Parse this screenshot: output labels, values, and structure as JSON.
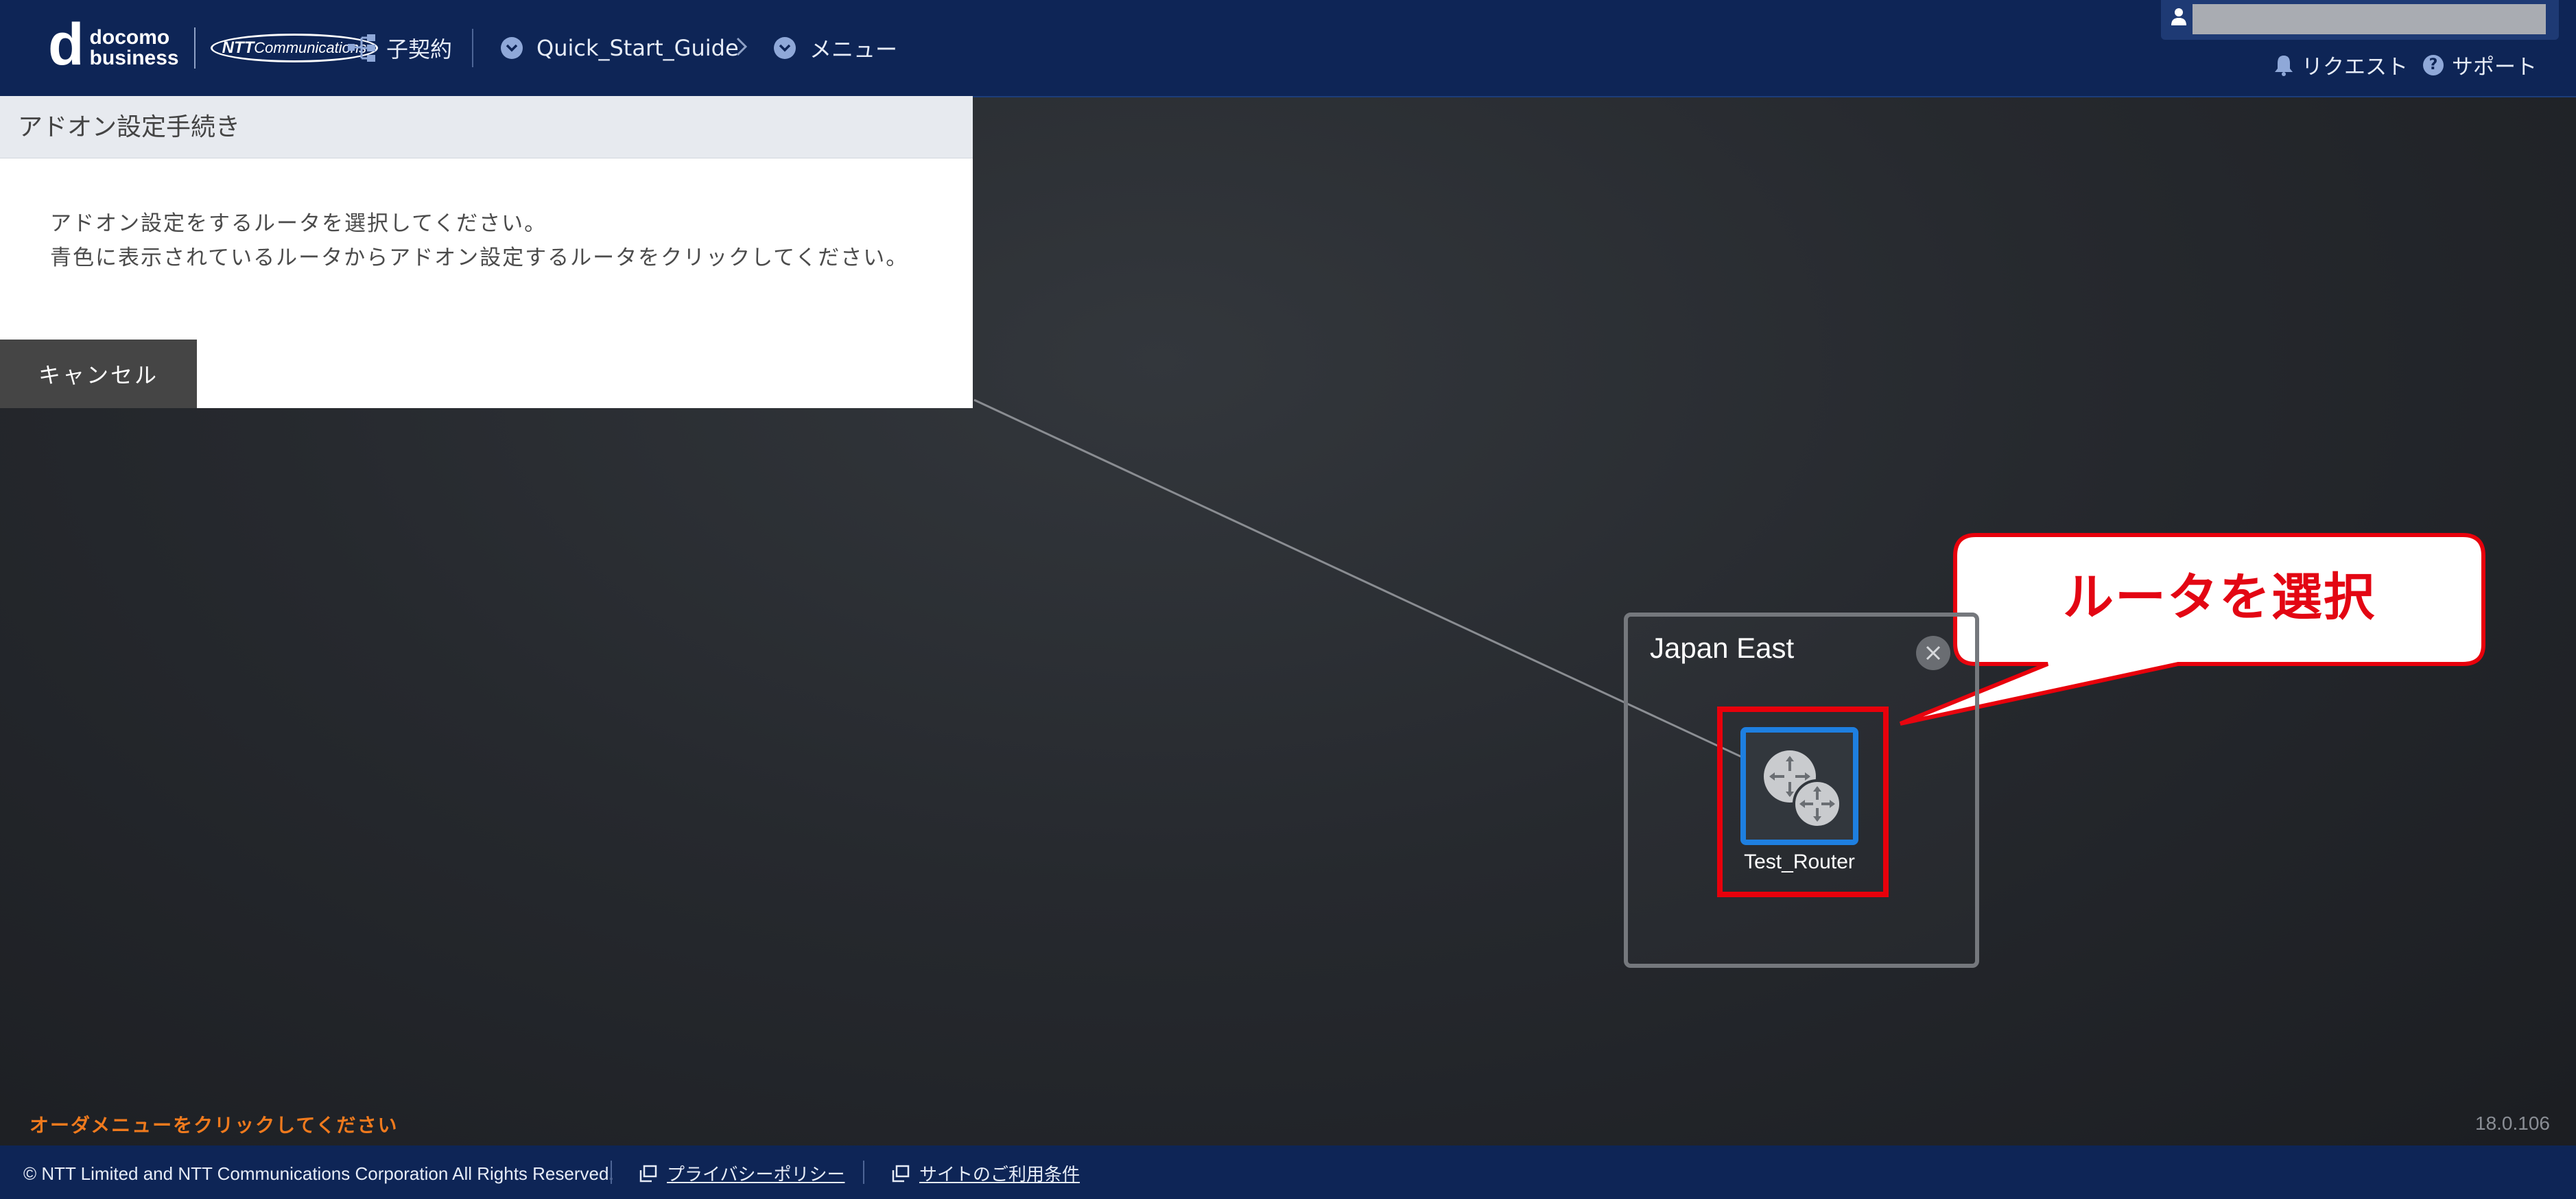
{
  "header": {
    "logo_d": "d",
    "logo_line1": "docomo",
    "logo_line2": "business",
    "ntt_logo_bold": "NTT",
    "ntt_logo_rest": "Communications",
    "contract_label": "子契約",
    "breadcrumb": [
      {
        "label": "Quick_Start_Guide"
      },
      {
        "label": "メニュー"
      }
    ],
    "request_label": "リクエスト",
    "support_label": "サポート",
    "help_glyph": "?"
  },
  "dialog": {
    "title": "アドオン設定手続き",
    "line1": "アドオン設定をするルータを選択してください。",
    "line2": "青色に表示されているルータからアドオン設定するルータをクリックしてください。",
    "cancel_label": "キャンセル"
  },
  "canvas": {
    "region_name": "Japan East",
    "router_name": "Test_Router",
    "callout_text": "ルータを選択",
    "order_hint": "オーダメニューをクリックしてください",
    "version": "18.0.106"
  },
  "footer": {
    "copyright": "© NTT Limited and NTT Communications Corporation All Rights Reserved.",
    "privacy_label": "プライバシーポリシー",
    "terms_label": "サイトのご利用条件"
  },
  "colors": {
    "header_bg": "#0e2556",
    "router_border": "#1e7fe0",
    "highlight": "#e8000b",
    "callout_text": "#e30613",
    "order_hint": "#f07a1d"
  },
  "icons": [
    "user-icon",
    "contract-tree-icon",
    "chevron-down-icon",
    "chevron-right-icon",
    "bell-icon",
    "help-icon",
    "close-icon",
    "router-icon",
    "external-window-icon"
  ]
}
